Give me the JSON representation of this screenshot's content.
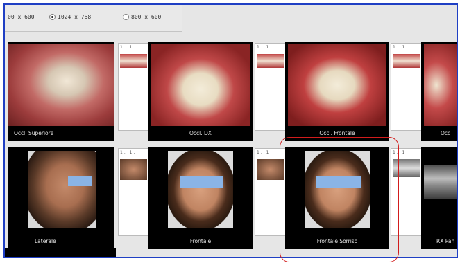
{
  "toolbar": {
    "options": [
      {
        "label": "00 x 600",
        "selected": false
      },
      {
        "label": "1024 x 768",
        "selected": true
      },
      {
        "label": "800 x 600",
        "selected": false
      }
    ]
  },
  "gallery": {
    "row1": [
      {
        "label": "Occl. Superiore"
      },
      {
        "label": "Occl. DX"
      },
      {
        "label": "Occl. Frontale"
      },
      {
        "label": "Occ"
      }
    ],
    "row2": [
      {
        "label": "Laterale"
      },
      {
        "label": "Frontale"
      },
      {
        "label": "Frontale Sorriso"
      },
      {
        "label": "RX Pan"
      }
    ],
    "thumb_nums": "1. 1."
  },
  "colors": {
    "frame_border": "#1f3fc4",
    "highlight": "#d21c1c",
    "tile_bg": "#000000",
    "face_bar": "#8ab4e6"
  }
}
